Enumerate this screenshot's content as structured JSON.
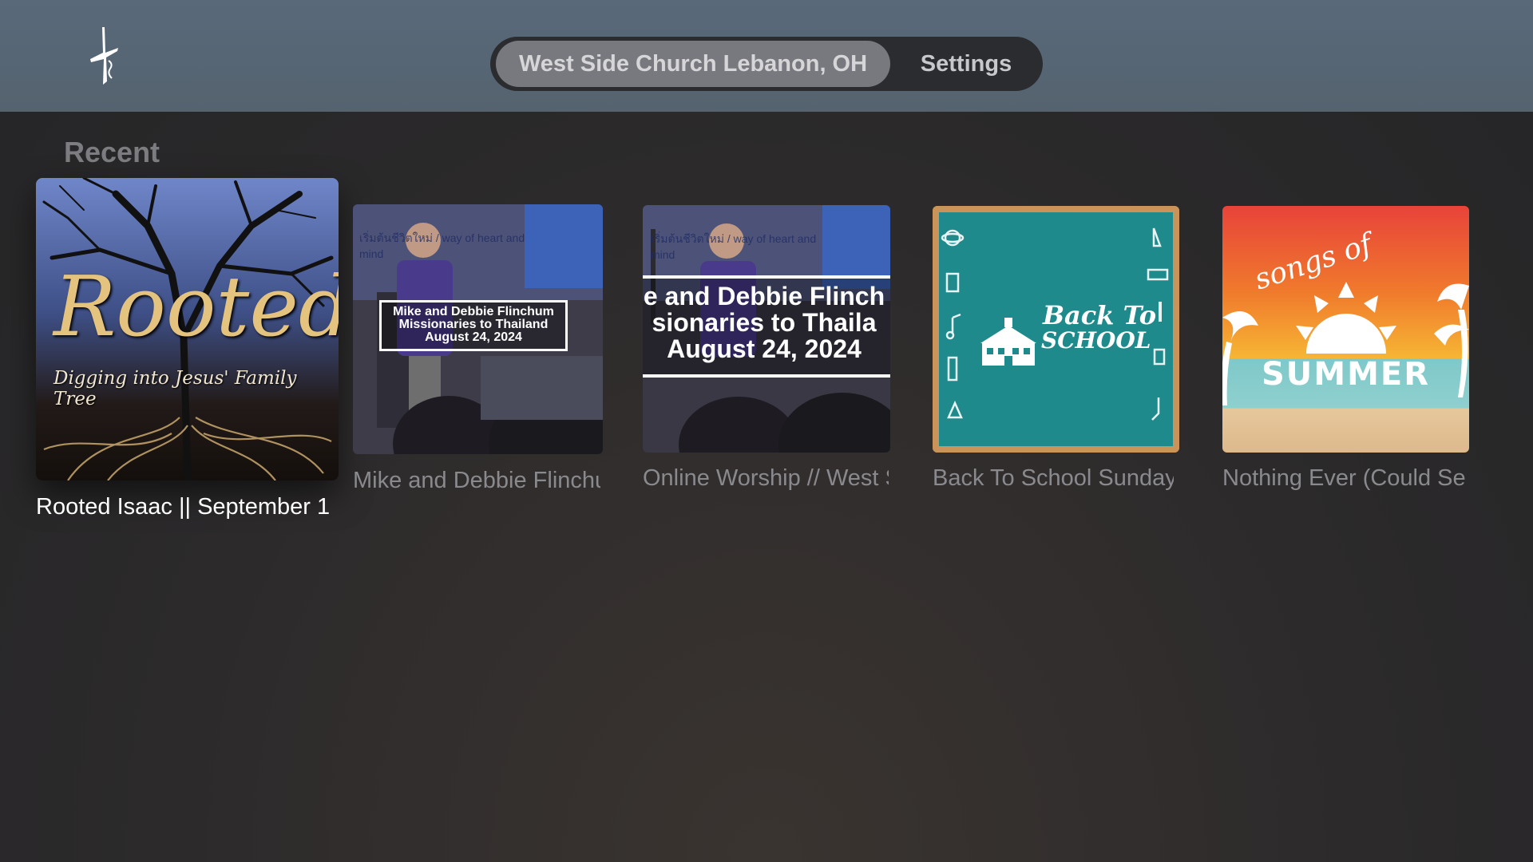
{
  "header": {
    "logo_icon": "cross-logo-icon",
    "tabs": [
      {
        "label": "West Side Church Lebanon, OH",
        "selected": true
      },
      {
        "label": "Settings",
        "selected": false
      }
    ]
  },
  "recent": {
    "title": "Recent",
    "items": [
      {
        "caption": "Rooted Isaac || September 1",
        "art": {
          "title": "Rooted",
          "subtitle": "Digging into Jesus' Family Tree"
        },
        "focused": true
      },
      {
        "caption": "Mike and Debbie Flinchum",
        "art": {
          "wall_text": "เริ่มต้นชีวิตใหม่ / way of heart and mind",
          "lines": [
            "Mike and Debbie Flinchum",
            "Missionaries to Thailand",
            "August 24, 2024"
          ]
        },
        "focused": false
      },
      {
        "caption": "Online Worship // West Side",
        "art": {
          "wall_text": "เริ่มต้นชีวิตใหม่ / way of heart and mind",
          "lines": [
            "e and Debbie Flinch",
            "sionaries to Thaila",
            "August 24, 2024"
          ]
        },
        "focused": false
      },
      {
        "caption": "Back To School Sunday",
        "art": {
          "line1": "Back To",
          "line2": "SCHOOL"
        },
        "focused": false
      },
      {
        "caption": "Nothing Ever (Could Separate Us)",
        "art": {
          "line1": "songs of",
          "line2": "SUMMER"
        },
        "focused": false
      }
    ]
  },
  "colors": {
    "topbar": "#57667a",
    "pill_bg": "#2b2c30",
    "pill_selected": "#78797e",
    "chalkboard": "#1f8a8c",
    "frame": "#c9935a"
  }
}
